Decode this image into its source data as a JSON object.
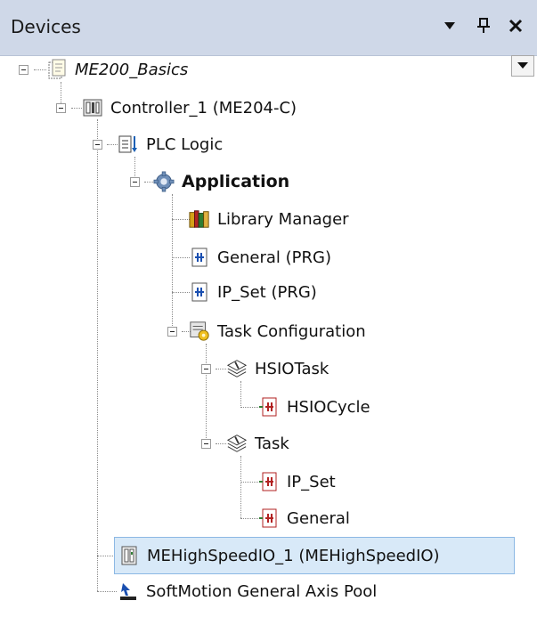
{
  "panel": {
    "title": "Devices",
    "dropdown_icon": "caret-down-icon",
    "pin_icon": "pin-icon",
    "close_icon": "close-icon"
  },
  "tree": {
    "project": "ME200_Basics",
    "controller": "Controller_1 (ME204-C)",
    "plc_logic": "PLC Logic",
    "application": "Application",
    "library_manager": "Library Manager",
    "general_prg": "General (PRG)",
    "ipset_prg": "IP_Set (PRG)",
    "task_configuration": "Task Configuration",
    "hsio_task": "HSIOTask",
    "hsio_cycle": "HSIOCycle",
    "task": "Task",
    "task_ipset": "IP_Set",
    "task_general": "General",
    "mehighspeedio": "MEHighSpeedIO_1 (MEHighSpeedIO)",
    "softmotion": "SoftMotion General Axis Pool"
  },
  "colors": {
    "titlebar": "#cfd8e8",
    "selection": "#d8e9f8",
    "selection_border": "#8cb8e4"
  }
}
